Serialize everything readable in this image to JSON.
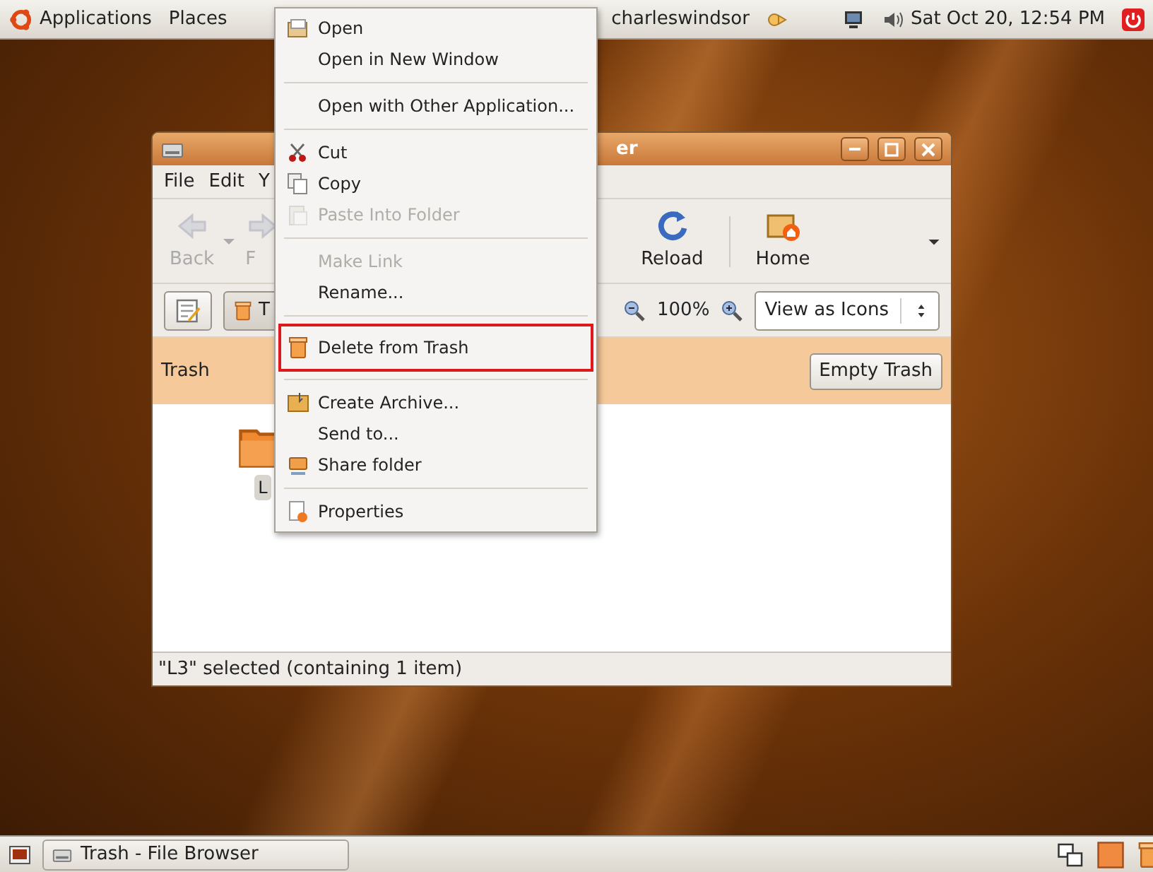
{
  "top_panel": {
    "menus": [
      "Applications",
      "Places"
    ],
    "user": "charleswindsor",
    "clock": "Sat Oct 20, 12:54 PM"
  },
  "window": {
    "title": "er",
    "menubar": [
      "File",
      "Edit",
      "Y"
    ],
    "toolbar": [
      {
        "kind": "back",
        "label": "Back",
        "disabled": true
      },
      {
        "kind": "forward",
        "label": "F",
        "disabled": true
      },
      {
        "kind": "reload",
        "label": "Reload",
        "disabled": false
      },
      {
        "kind": "home",
        "label": "Home",
        "disabled": false
      }
    ],
    "location_button": "T",
    "zoom": "100%",
    "view_mode": "View as Icons",
    "info_bar": {
      "title": "Trash",
      "button": "Empty Trash"
    },
    "files": [
      {
        "label": "L",
        "selected": true
      }
    ],
    "status": "\"L3\" selected (containing 1 item)"
  },
  "context_menu": {
    "items": [
      {
        "kind": "item",
        "label": "Open",
        "disabled": false,
        "highlighted": false
      },
      {
        "kind": "item",
        "label": "Open in New Window",
        "disabled": false,
        "highlighted": false
      },
      {
        "kind": "separator"
      },
      {
        "kind": "item",
        "label": "Open with Other Application...",
        "disabled": false,
        "highlighted": false
      },
      {
        "kind": "separator"
      },
      {
        "kind": "item",
        "label": "Cut",
        "disabled": false,
        "highlighted": false
      },
      {
        "kind": "item",
        "label": "Copy",
        "disabled": false,
        "highlighted": false
      },
      {
        "kind": "item",
        "label": "Paste Into Folder",
        "disabled": true,
        "highlighted": false
      },
      {
        "kind": "separator"
      },
      {
        "kind": "item",
        "label": "Make Link",
        "disabled": true,
        "highlighted": false
      },
      {
        "kind": "item",
        "label": "Rename...",
        "disabled": false,
        "highlighted": false
      },
      {
        "kind": "separator"
      },
      {
        "kind": "item",
        "label": "Delete from Trash",
        "disabled": false,
        "highlighted": true
      },
      {
        "kind": "separator"
      },
      {
        "kind": "item",
        "label": "Create Archive...",
        "disabled": false,
        "highlighted": false
      },
      {
        "kind": "item",
        "label": "Send to...",
        "disabled": false,
        "highlighted": false
      },
      {
        "kind": "item",
        "label": "Share folder",
        "disabled": false,
        "highlighted": false
      },
      {
        "kind": "separator"
      },
      {
        "kind": "item",
        "label": "Properties",
        "disabled": false,
        "highlighted": false
      }
    ]
  },
  "taskbar": {
    "tasks": [
      {
        "label": "Trash - File Browser",
        "selected": false
      }
    ]
  }
}
